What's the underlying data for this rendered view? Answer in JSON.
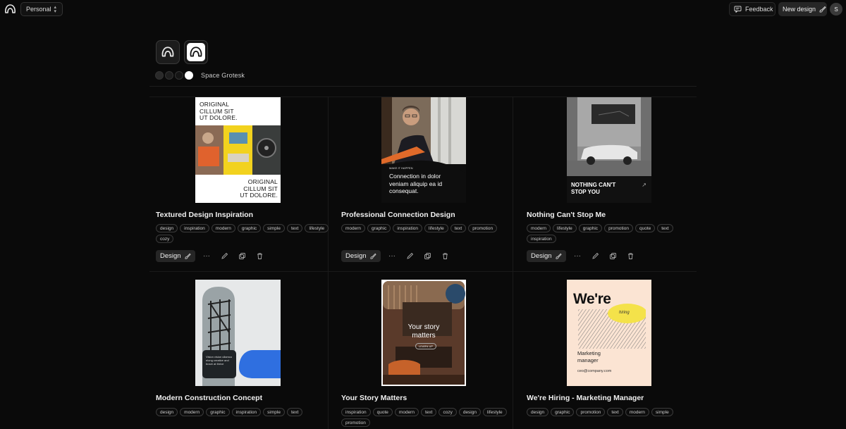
{
  "topbar": {
    "workspace": "Personal",
    "feedback_label": "Feedback",
    "new_design_label": "New design",
    "avatar_initial": "S"
  },
  "brand": {
    "font_name": "Space Grotesk",
    "colors": [
      "#2a2a2a",
      "#1e1e1e",
      "#151515",
      "#ffffff"
    ]
  },
  "cards": [
    {
      "title": "Textured Design Inspiration",
      "tags": [
        "design",
        "inspiration",
        "modern",
        "graphic",
        "simple",
        "text",
        "lifestyle",
        "cozy"
      ],
      "design_label": "Design",
      "thumb_text": {
        "top": "ORIGINAL\nCILLUM SIT\nUT DOLORE.",
        "bottom": "ORIGINAL\nCILLUM SIT\nUT DOLORE."
      }
    },
    {
      "title": "Professional Connection Design",
      "tags": [
        "modern",
        "graphic",
        "inspiration",
        "lifestyle",
        "text",
        "promotion"
      ],
      "design_label": "Design",
      "thumb_text": {
        "eyebrow": "MAKE IT HAPPEN",
        "headline": "Connection in dolor veniam aliquip ea id consequat."
      }
    },
    {
      "title": "Nothing Can't Stop Me",
      "tags": [
        "modern",
        "lifestyle",
        "graphic",
        "promotion",
        "quote",
        "text",
        "inspiration"
      ],
      "design_label": "Design",
      "thumb_text": {
        "headline": "NOTHING CAN'T\nSTOP YOU"
      }
    },
    {
      "title": "Modern Construction Concept",
      "tags": [
        "design",
        "modern",
        "graphic",
        "inspiration",
        "simple",
        "text"
      ],
      "thumb_text": {
        "body": "Vision vision ullamco elong creative and brave at thrive"
      }
    },
    {
      "title": "Your Story Matters",
      "tags": [
        "inspiration",
        "quote",
        "modern",
        "text",
        "cozy",
        "design",
        "lifestyle",
        "promotion"
      ],
      "thumb_text": {
        "headline": "Your story matters",
        "pill": "LEARN UP"
      }
    },
    {
      "title": "We're Hiring - Marketing Manager",
      "tags": [
        "design",
        "graphic",
        "promotion",
        "text",
        "modern",
        "simple"
      ],
      "thumb_text": {
        "big": "We're",
        "hiring": "hiring",
        "role": "Marketing\nmanager",
        "email": "ceo@company.com"
      }
    }
  ]
}
